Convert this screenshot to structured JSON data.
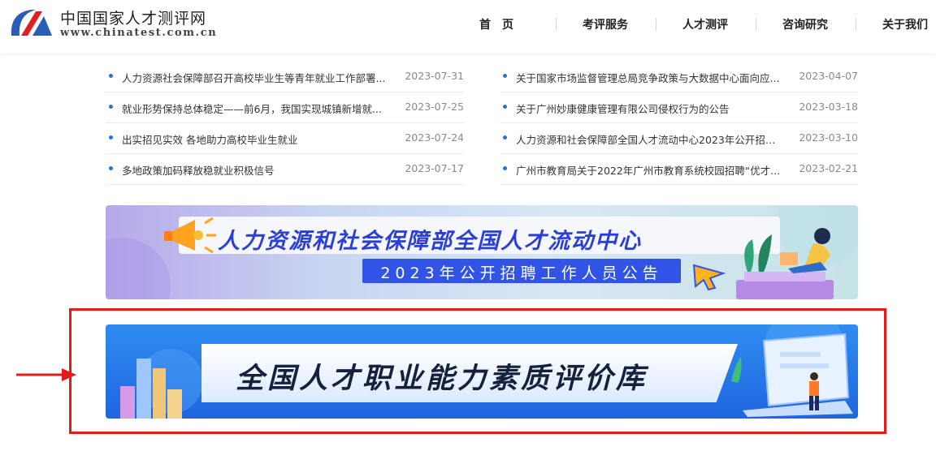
{
  "site": {
    "name": "中国国家人才测评网",
    "url": "www.chinatest.com.cn"
  },
  "nav": {
    "items": [
      "首　页",
      "考评服务",
      "人才测评",
      "咨询研究",
      "关于我们"
    ]
  },
  "news_left": [
    {
      "title": "人力资源社会保障部召开高校毕业生等青年就业工作部署...",
      "date": "2023-07-31"
    },
    {
      "title": "就业形势保持总体稳定——前6月，我国实现城镇新增就...",
      "date": "2023-07-25"
    },
    {
      "title": "出实招见实效 各地助力高校毕业生就业",
      "date": "2023-07-24"
    },
    {
      "title": "多地政策加码释放稳就业积极信号",
      "date": "2023-07-17"
    }
  ],
  "news_right": [
    {
      "title": "关于国家市场监督管理总局竞争政策与大数据中心面向应...",
      "date": "2023-04-07"
    },
    {
      "title": "关于广州妙康健康管理有限公司侵权行为的公告",
      "date": "2023-03-18"
    },
    {
      "title": "人力资源和社会保障部全国人才流动中心2023年公开招聘...",
      "date": "2023-03-10"
    },
    {
      "title": "广州市教育局关于2022年广州市教育系统校园招聘“优才...",
      "date": "2023-02-21"
    }
  ],
  "banner1": {
    "title": "人力资源和社会保障部全国人才流动中心",
    "subtitle": "2023年公开招聘工作人员公告"
  },
  "banner2": {
    "title": "全国人才职业能力素质评价库"
  },
  "colors": {
    "accent": "#2f6fd0",
    "highlight": "#e31b1b",
    "banner2_bg": "#2f8cf0"
  }
}
